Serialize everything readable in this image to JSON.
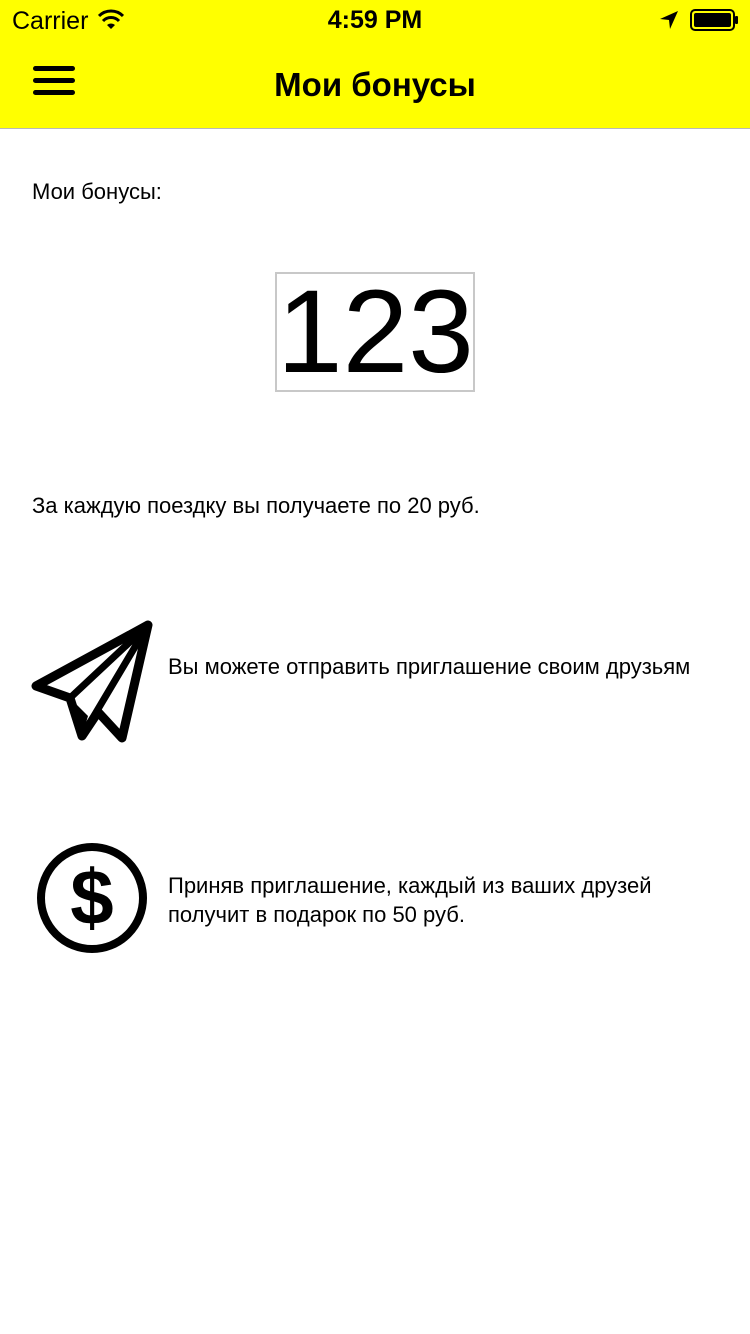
{
  "status_bar": {
    "carrier": "Carrier",
    "time": "4:59 PM",
    "icons": [
      "wifi-icon",
      "location-arrow-icon",
      "battery-icon"
    ]
  },
  "header": {
    "title": "Мои бонусы",
    "background_color": "#ffff00",
    "menu_icon": "hamburger-menu-icon"
  },
  "main": {
    "section_label": "Мои бонусы:",
    "bonus_value": "123",
    "ride_text": "За каждую поездку вы получаете по 20 руб.",
    "features": [
      {
        "icon": "paper-plane-icon",
        "text": "Вы можете отправить приглашение своим друзьям"
      },
      {
        "icon": "dollar-icon",
        "text": "Приняв приглашение, каждый из ваших друзей получит в подарок по 50 руб."
      }
    ]
  }
}
